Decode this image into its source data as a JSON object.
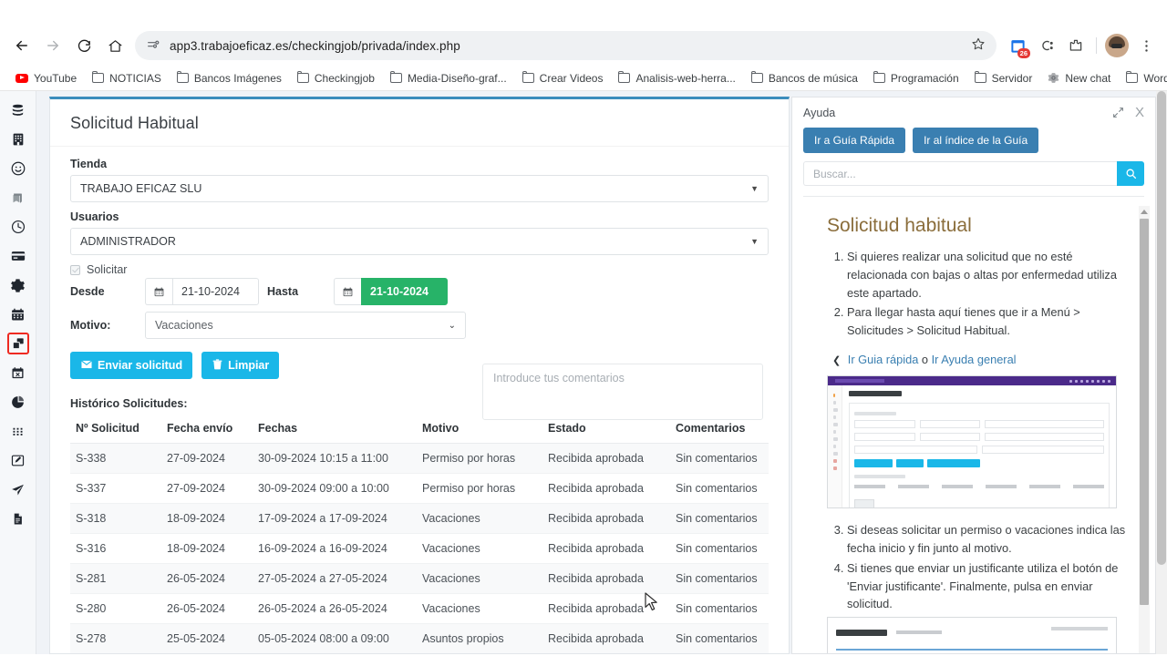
{
  "browser": {
    "url": "app3.trabajoeficaz.es/checkingjob/privada/index.php",
    "back_label": "Back",
    "forward_label": "Forward",
    "reload_label": "Reload",
    "home_label": "Home",
    "site_info_label": "View site information",
    "bookmark_star_label": "Bookmark this tab",
    "extension_badge": "26",
    "bookmarks": [
      {
        "label": "YouTube",
        "icon": "youtube-icon"
      },
      {
        "label": "NOTICIAS",
        "icon": "folder-icon"
      },
      {
        "label": "Bancos Imágenes",
        "icon": "folder-icon"
      },
      {
        "label": "Checkingjob",
        "icon": "folder-icon"
      },
      {
        "label": "Media-Diseño-graf...",
        "icon": "folder-icon"
      },
      {
        "label": "Crear Videos",
        "icon": "folder-icon"
      },
      {
        "label": "Analisis-web-herra...",
        "icon": "folder-icon"
      },
      {
        "label": "Bancos de música",
        "icon": "folder-icon"
      },
      {
        "label": "Programación",
        "icon": "folder-icon"
      },
      {
        "label": "Servidor",
        "icon": "folder-icon"
      },
      {
        "label": "New chat",
        "icon": "gear-icon"
      },
      {
        "label": "Wordpress",
        "icon": "folder-icon"
      }
    ],
    "bookmarks_overflow": "»"
  },
  "rail": {
    "items": [
      {
        "name": "database-icon"
      },
      {
        "name": "building-icon"
      },
      {
        "name": "smiley-icon"
      },
      {
        "name": "book-icon"
      },
      {
        "name": "clock-icon"
      },
      {
        "name": "card-icon"
      },
      {
        "name": "gear-icon"
      },
      {
        "name": "calendar-icon"
      },
      {
        "name": "windows-icon",
        "active": true
      },
      {
        "name": "calendar-x-icon"
      },
      {
        "name": "pie-chart-icon"
      },
      {
        "name": "grid-icon"
      },
      {
        "name": "edit-icon"
      },
      {
        "name": "send-icon"
      },
      {
        "name": "document-icon"
      }
    ]
  },
  "form": {
    "title": "Solicitud Habitual",
    "tienda_label": "Tienda",
    "tienda_value": "TRABAJO EFICAZ SLU",
    "usuarios_label": "Usuarios",
    "usuarios_value": "ADMINISTRADOR",
    "solicitar_label": "Solicitar",
    "desde_label": "Desde",
    "desde_value": "21-10-2024",
    "hasta_label": "Hasta",
    "hasta_value": "21-10-2024",
    "motivo_label": "Motivo:",
    "motivo_value": "Vacaciones",
    "motivo_options": [
      "Vacaciones",
      "Permiso por horas",
      "Asuntos propios"
    ],
    "comentarios_placeholder": "Introduce tus comentarios",
    "comentarios_value": "",
    "enviar_label": "Enviar solicitud",
    "limpiar_label": "Limpiar",
    "accent_cyan": "#1ab7e8",
    "accent_green": "#27b368",
    "card_top_border": "#3c8dbc"
  },
  "history": {
    "title": "Histórico Solicitudes:",
    "columns": [
      "Nº Solicitud",
      "Fecha envío",
      "Fechas",
      "Motivo",
      "Estado",
      "Comentarios"
    ],
    "rows": [
      [
        "S-338",
        "27-09-2024",
        "30-09-2024 10:15 a 11:00",
        "Permiso por horas",
        "Recibida aprobada",
        "Sin comentarios"
      ],
      [
        "S-337",
        "27-09-2024",
        "30-09-2024 09:00 a 10:00",
        "Permiso por horas",
        "Recibida aprobada",
        "Sin comentarios"
      ],
      [
        "S-318",
        "18-09-2024",
        "17-09-2024 a 17-09-2024",
        "Vacaciones",
        "Recibida aprobada",
        "Sin comentarios"
      ],
      [
        "S-316",
        "18-09-2024",
        "16-09-2024 a 16-09-2024",
        "Vacaciones",
        "Recibida aprobada",
        "Sin comentarios"
      ],
      [
        "S-281",
        "26-05-2024",
        "27-05-2024 a 27-05-2024",
        "Vacaciones",
        "Recibida aprobada",
        "Sin comentarios"
      ],
      [
        "S-280",
        "26-05-2024",
        "26-05-2024 a 26-05-2024",
        "Vacaciones",
        "Recibida aprobada",
        "Sin comentarios"
      ],
      [
        "S-278",
        "25-05-2024",
        "05-05-2024 08:00 a 09:00",
        "Asuntos propios",
        "Recibida aprobada",
        "Sin comentarios"
      ]
    ]
  },
  "help": {
    "title": "Ayuda",
    "expand_label": "Expandir",
    "close_label": "X",
    "btn_quickguide": "Ir a Guía Rápida",
    "btn_index": "Ir al índice de la Guía",
    "search_placeholder": "Buscar...",
    "search_value": "",
    "heading": "Solicitud habitual",
    "steps": [
      "Si quieres realizar una solicitud que no esté relacionada con bajas o altas por enfermedad utiliza este apartado.",
      "Para llegar hasta aquí tienes que ir a Menú > Solicitudes > Solicitud Habitual.",
      "Si deseas solicitar un permiso o vacaciones indica las fecha inicio y fin junto al motivo.",
      "Si tienes que enviar un justificante utiliza el botón de 'Enviar justificante'. Finalmente, pulsa en enviar solicitud."
    ],
    "link_prev": "Ir Guia rápida",
    "link_sep": "o",
    "link_general": "Ir Ayuda general",
    "btn_color": "#3a7fb1"
  }
}
